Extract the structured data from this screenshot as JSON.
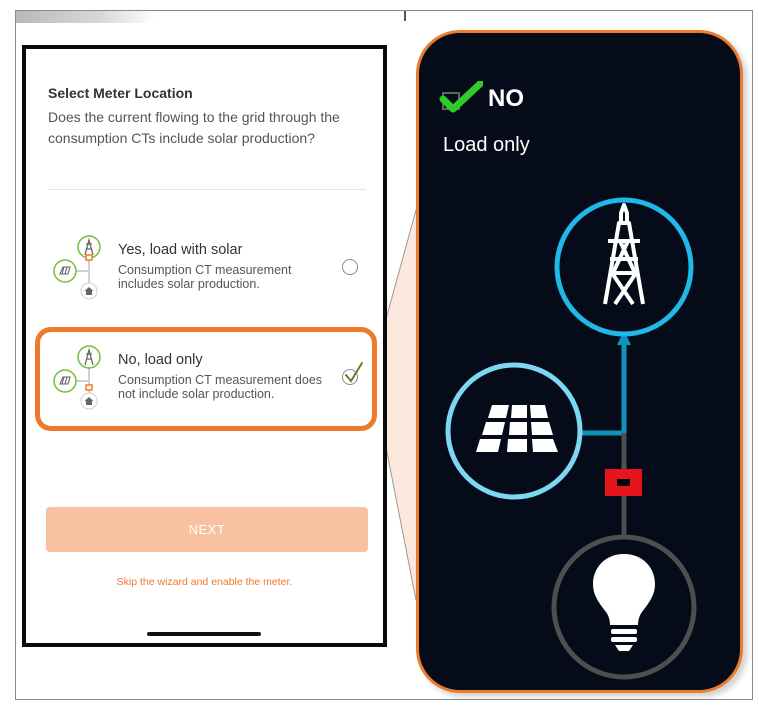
{
  "phone": {
    "title": "Select Meter Location",
    "question": "Does the current flowing to the grid through the consumption CTs include solar production?",
    "options": [
      {
        "label": "Yes, load with solar",
        "description": "Consumption CT measurement includes solar production.",
        "selected": false
      },
      {
        "label": "No, load only",
        "description": "Consumption CT measurement does not include solar production.",
        "selected": true
      }
    ],
    "next_label": "NEXT",
    "skip_label": "Skip the wizard and enable the meter."
  },
  "callout": {
    "title": "NO",
    "subtitle": "Load only"
  },
  "colors": {
    "accent": "#ee7a2c",
    "next_button": "#f8c2a0",
    "callout_bg": "#060b19",
    "grid_ring": "#1fb9e8",
    "solar_ring": "#7dd7f2",
    "load_ring": "#4e4e4e",
    "flow_line": "#0f93b8",
    "meter": "#e5151b",
    "check_green": "#2fcb2a",
    "mini_icon_green": "#6fbf3a"
  },
  "icons": [
    "transmission-tower-icon",
    "solar-panel-icon",
    "house-icon",
    "lightbulb-icon",
    "checkmark-icon",
    "meter-icon"
  ]
}
